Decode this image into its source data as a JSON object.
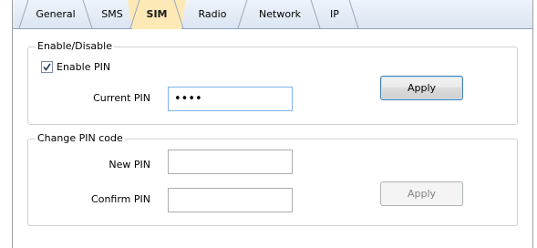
{
  "tabs": [
    {
      "label": "General",
      "active": false
    },
    {
      "label": "SMS",
      "active": false
    },
    {
      "label": "SIM",
      "active": true
    },
    {
      "label": "Radio",
      "active": false
    },
    {
      "label": "Network",
      "active": false
    },
    {
      "label": "IP",
      "active": false
    }
  ],
  "enable_group": {
    "legend": "Enable/Disable",
    "enable_pin_label": "Enable PIN",
    "enable_pin_checked": true,
    "current_pin_label": "Current PIN",
    "current_pin_value": "••••",
    "apply_label": "Apply",
    "apply_enabled": true
  },
  "change_group": {
    "legend": "Change PIN code",
    "new_pin_label": "New PIN",
    "new_pin_value": "",
    "confirm_pin_label": "Confirm PIN",
    "confirm_pin_value": "",
    "apply_label": "Apply",
    "apply_enabled": false
  },
  "colors": {
    "active_tab": "#fde9b6",
    "tabbar": "#dbe5f2",
    "primary_button_border": "#3c7fb1",
    "focus_border": "#7eb4ea"
  }
}
